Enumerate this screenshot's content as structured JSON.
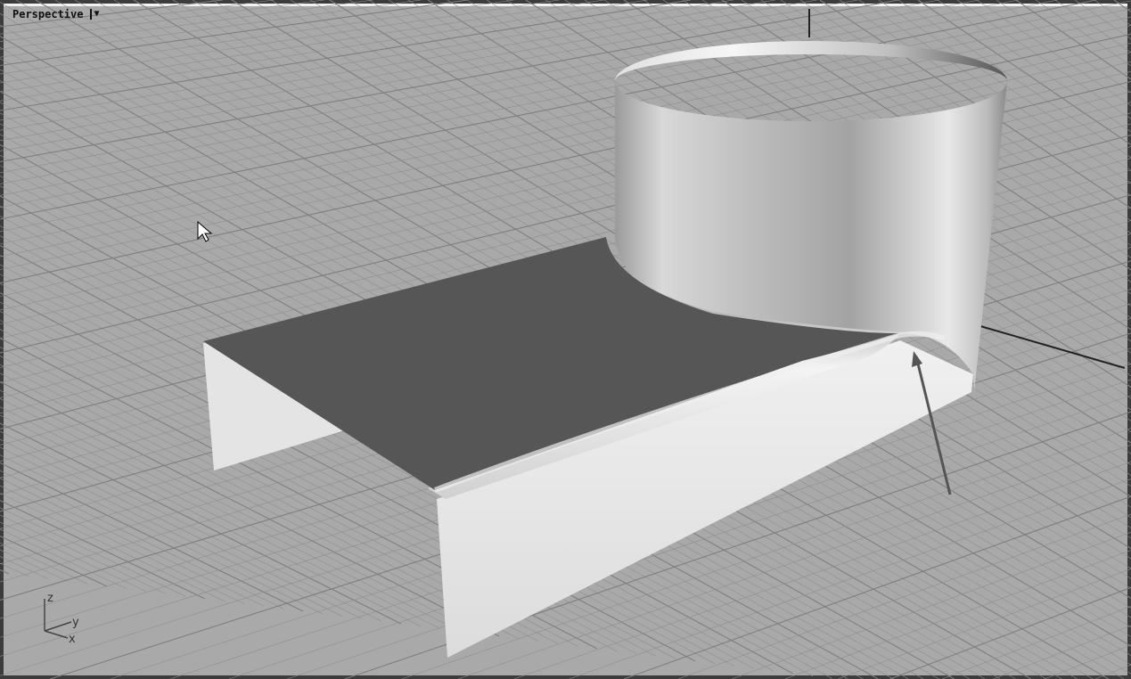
{
  "viewport": {
    "title": "Perspective",
    "menu_icon": "triangle-down-icon",
    "axis_labels": {
      "z": "z",
      "y": "y",
      "x": "x"
    }
  },
  "colors": {
    "background": "#a9a9a9",
    "grid": "#8e8e8e",
    "sheet_top": "#555555",
    "surface_light": "#e6e6e6"
  }
}
